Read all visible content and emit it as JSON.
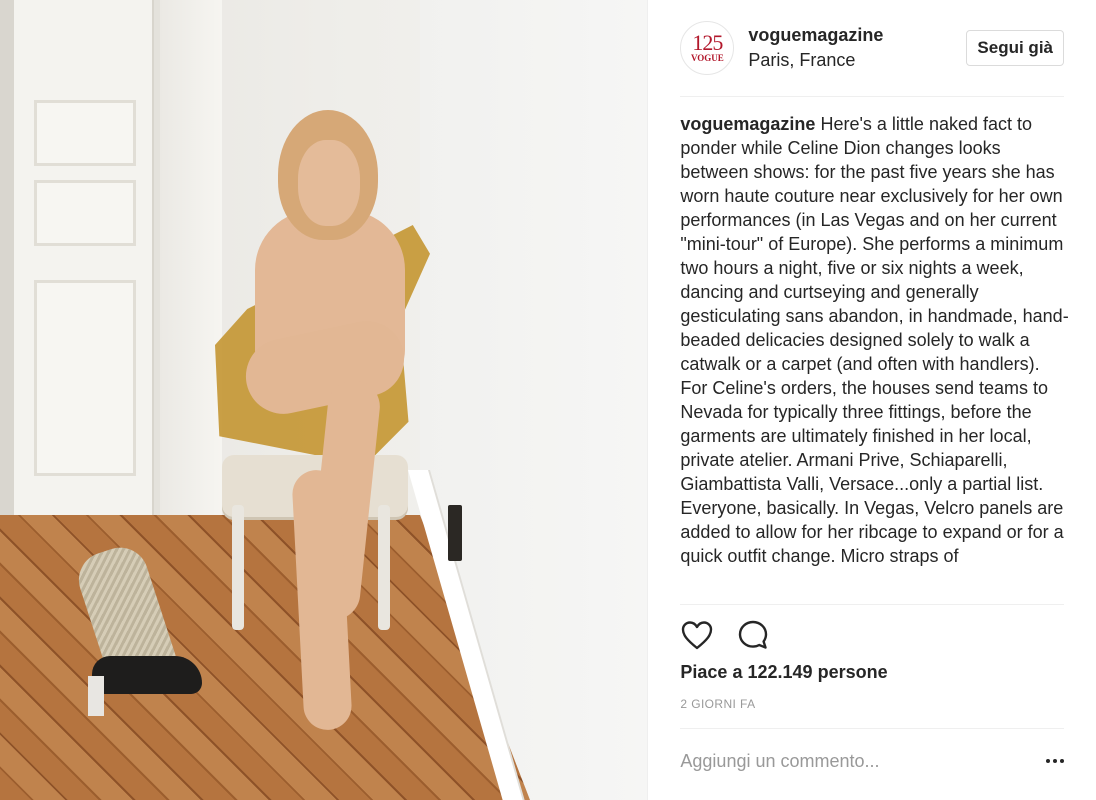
{
  "post": {
    "image_alt": "Photo of Celine Dion seated on a chair in a small white room with a parquet floor",
    "header": {
      "avatar_number": "125",
      "avatar_brand": "VOGUE",
      "username": "voguemagazine",
      "location": "Paris, France",
      "follow_label": "Segui già"
    },
    "caption": {
      "username": "voguemagazine",
      "text": "Here's a little naked fact to ponder while Celine Dion changes looks between shows: for the past five years she has worn haute couture near exclusively for her own performances (in Las Vegas and on her current \"mini-tour\" of Europe). She performs a minimum two hours a night, five or six nights a week, dancing and curtseying and generally gesticulating sans abandon, in handmade, hand-beaded delicacies designed solely to walk a catwalk or a carpet (and often with handlers). For Celine's orders, the houses send teams to Nevada for typically three fittings, before the garments are ultimately finished in her local, private atelier. Armani Prive, Schiaparelli, Giambattista Valli, Versace...only a partial list. Everyone, basically. In Vegas, Velcro panels are added to allow for her ribcage to expand or for a quick outfit change. Micro straps of"
    },
    "actions": {
      "like_icon": "heart-icon",
      "comment_icon": "comment-bubble-icon"
    },
    "likes": {
      "prefix": "Piace a",
      "count": "122.149",
      "suffix": "persone"
    },
    "timestamp": "2 GIORNI FA",
    "comment": {
      "placeholder": "Aggiungi un commento...",
      "more_icon": "more-options-icon"
    },
    "colors": {
      "brand_red": "#b2172b",
      "text": "#262626",
      "muted": "#999999",
      "border": "#efefef"
    }
  }
}
